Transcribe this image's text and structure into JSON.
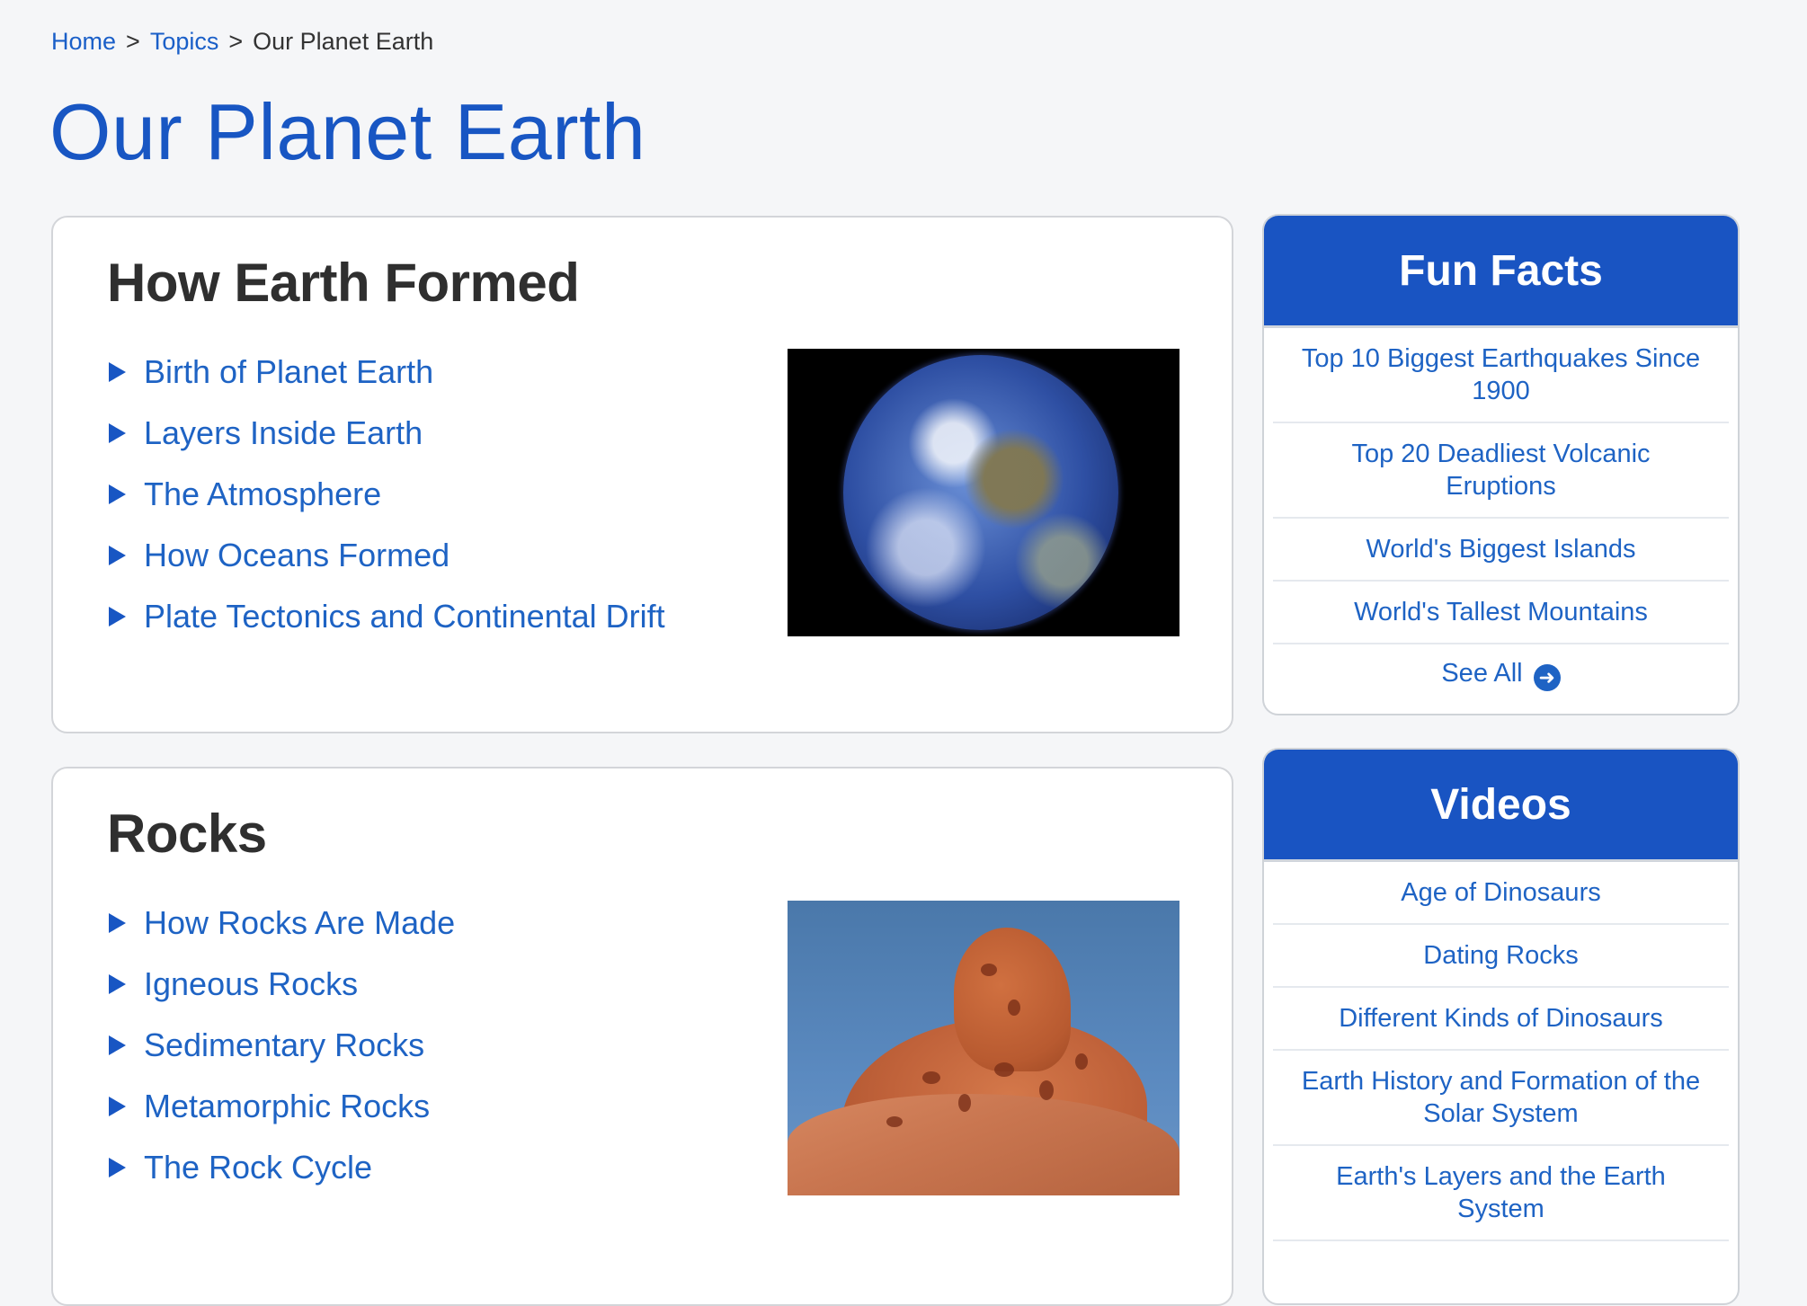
{
  "breadcrumb": {
    "items": [
      {
        "label": "Home",
        "link": true
      },
      {
        "label": "Topics",
        "link": true
      },
      {
        "label": "Our Planet Earth",
        "link": false
      }
    ],
    "separator": ">"
  },
  "page_title": "Our Planet Earth",
  "sections": [
    {
      "title": "How Earth Formed",
      "image": "earth-globe-photo",
      "links": [
        "Birth of Planet Earth",
        "Layers Inside Earth",
        "The Atmosphere",
        "How Oceans Formed",
        "Plate Tectonics and Continental Drift"
      ]
    },
    {
      "title": "Rocks",
      "image": "red-sandstone-rock-photo",
      "links": [
        "How Rocks Are Made",
        "Igneous Rocks",
        "Sedimentary Rocks",
        "Metamorphic Rocks",
        "The Rock Cycle"
      ]
    }
  ],
  "sidebar": {
    "fun_facts": {
      "title": "Fun Facts",
      "items": [
        "Top 10 Biggest Earthquakes Since 1900",
        "Top 20 Deadliest Volcanic Eruptions",
        "World's Biggest Islands",
        "World's Tallest Mountains"
      ],
      "see_all": "See All",
      "see_all_icon": "arrow-circle-right-icon"
    },
    "videos": {
      "title": "Videos",
      "items": [
        "Age of Dinosaurs",
        "Dating Rocks",
        "Different Kinds of Dinosaurs",
        "Earth History and Formation of the Solar System",
        "Earth's Layers and the Earth System"
      ]
    }
  },
  "colors": {
    "accent": "#1954c2",
    "link": "#1e63c4",
    "heading": "#2f2f2f",
    "background": "#f5f6f8"
  }
}
